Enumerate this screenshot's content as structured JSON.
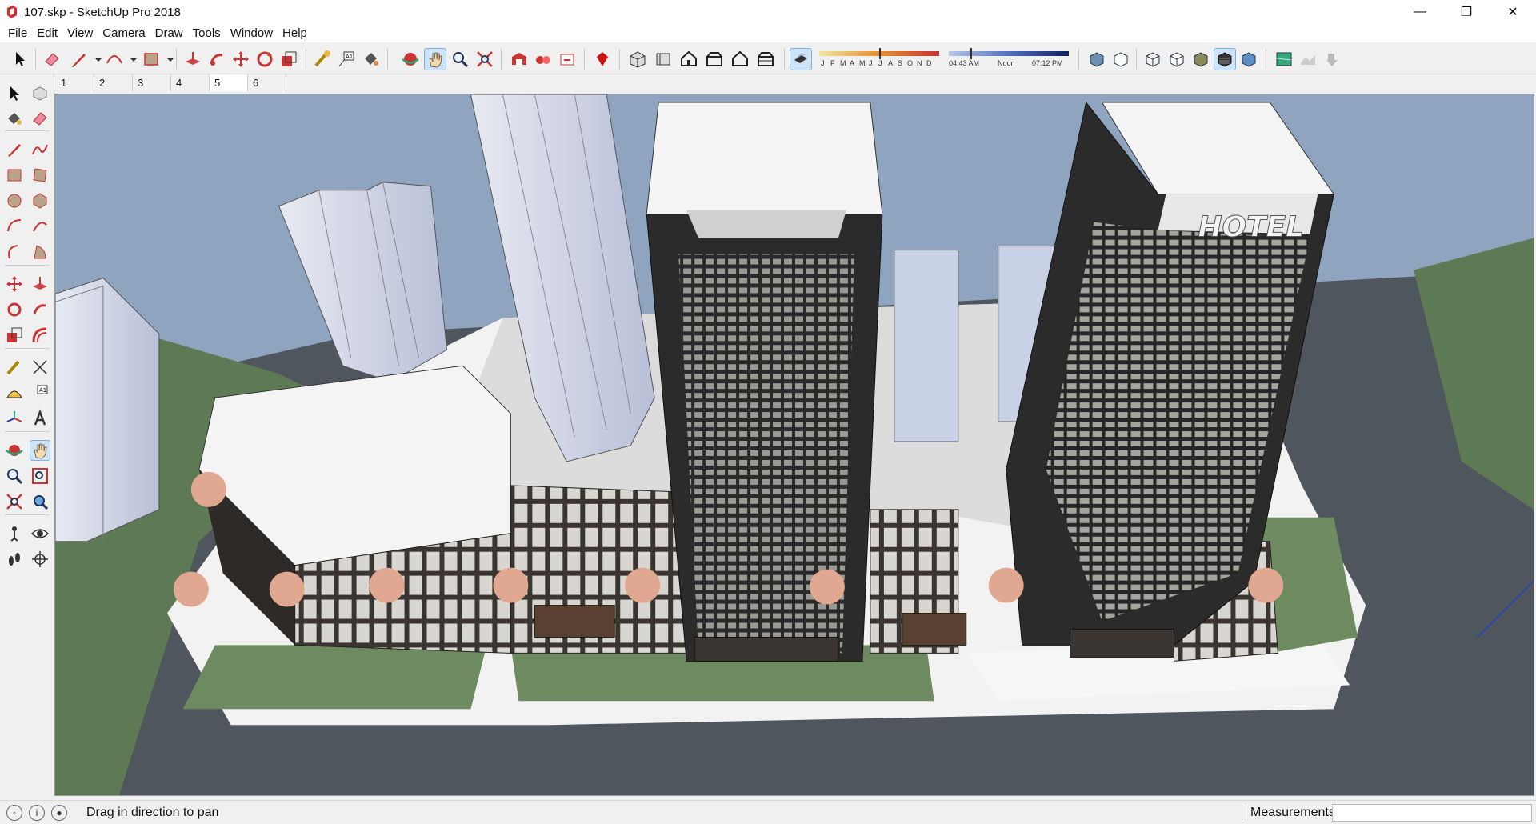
{
  "window": {
    "title": "107.skp - SketchUp Pro 2018",
    "controls": {
      "minimize": "—",
      "restore": "❐",
      "close": "✕"
    }
  },
  "menu": [
    "File",
    "Edit",
    "View",
    "Camera",
    "Draw",
    "Tools",
    "Window",
    "Help"
  ],
  "shadows": {
    "months": [
      "J",
      "F",
      "M",
      "A",
      "M",
      "J",
      "J",
      "A",
      "S",
      "O",
      "N",
      "D"
    ],
    "time_start": "04:43 AM",
    "time_mid": "Noon",
    "time_end": "07:12 PM"
  },
  "scene_tabs": [
    "1",
    "2",
    "3",
    "4",
    "5",
    "6"
  ],
  "selected_scene": "5",
  "viewport": {
    "sign_text": "HOTEL",
    "colors": {
      "sky": "#8fa5bf",
      "grass": "#5e7a55",
      "road": "#4f565d",
      "facade": "#2b2b2b",
      "roof": "#f4f4f4",
      "glass": "#c9d1e6"
    }
  },
  "status": {
    "message": "Drag in direction to pan",
    "measurements_label": "Measurements",
    "measurements_value": ""
  }
}
